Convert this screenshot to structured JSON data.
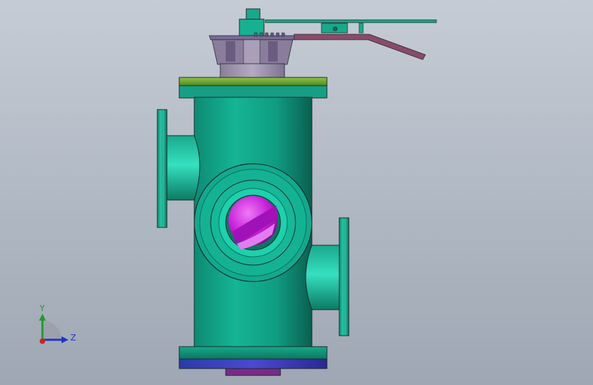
{
  "triad": {
    "y_label": "Y",
    "z_label": "Z",
    "colors": {
      "y": "#1f9a2e",
      "z": "#1d35c9",
      "x": "#d02020",
      "cone": "#9aa0a8"
    }
  },
  "model": {
    "colors": {
      "body": "#12a98c",
      "body_dark": "#0b6f5c",
      "body_light": "#2fd0b0",
      "top_flange": "#7fb33a",
      "bottom_ring": "#3b35a8",
      "stem_collar": "#9a8fa8",
      "handle": "#8a4a6a",
      "gear": "#6a5a88",
      "inner_plug": "#c31fd8",
      "inner_plug_light": "#e866f2",
      "edge": "#1a2a28"
    }
  }
}
